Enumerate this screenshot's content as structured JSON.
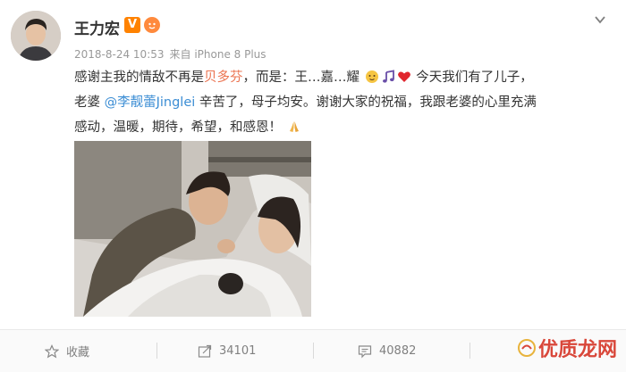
{
  "post": {
    "username": "王力宏",
    "verified_badge": "V",
    "timestamp": "2018-8-24 10:53",
    "source": "来自 iPhone 8 Plus",
    "text": {
      "line1_a": "感谢主我的情敌不再是",
      "line1_highlight": "贝多芬",
      "line1_b": "，而是：王…嘉…耀",
      "line1_c": "今天我们有了儿子，",
      "line2_a": "老婆 ",
      "line2_mention": "@李靓蕾Jinglei",
      "line2_b": " 辛苦了，母子均安。谢谢大家的祝福，我跟老婆的心里充满",
      "line3": "感动，温暖，期待，希望，和感恩！"
    },
    "emojis": [
      "baby-face-emoji",
      "music-note-emoji",
      "red-heart-emoji",
      "praying-hands-emoji"
    ]
  },
  "actions": {
    "favorite_label": "收藏",
    "repost_count": "34101",
    "comment_count": "40882"
  },
  "watermark": {
    "text": "优质龙网"
  },
  "colors": {
    "highlight": "#eb7350",
    "mention": "#3b8dd4",
    "verified": "#ff8200",
    "watermark": "#d9473a"
  }
}
